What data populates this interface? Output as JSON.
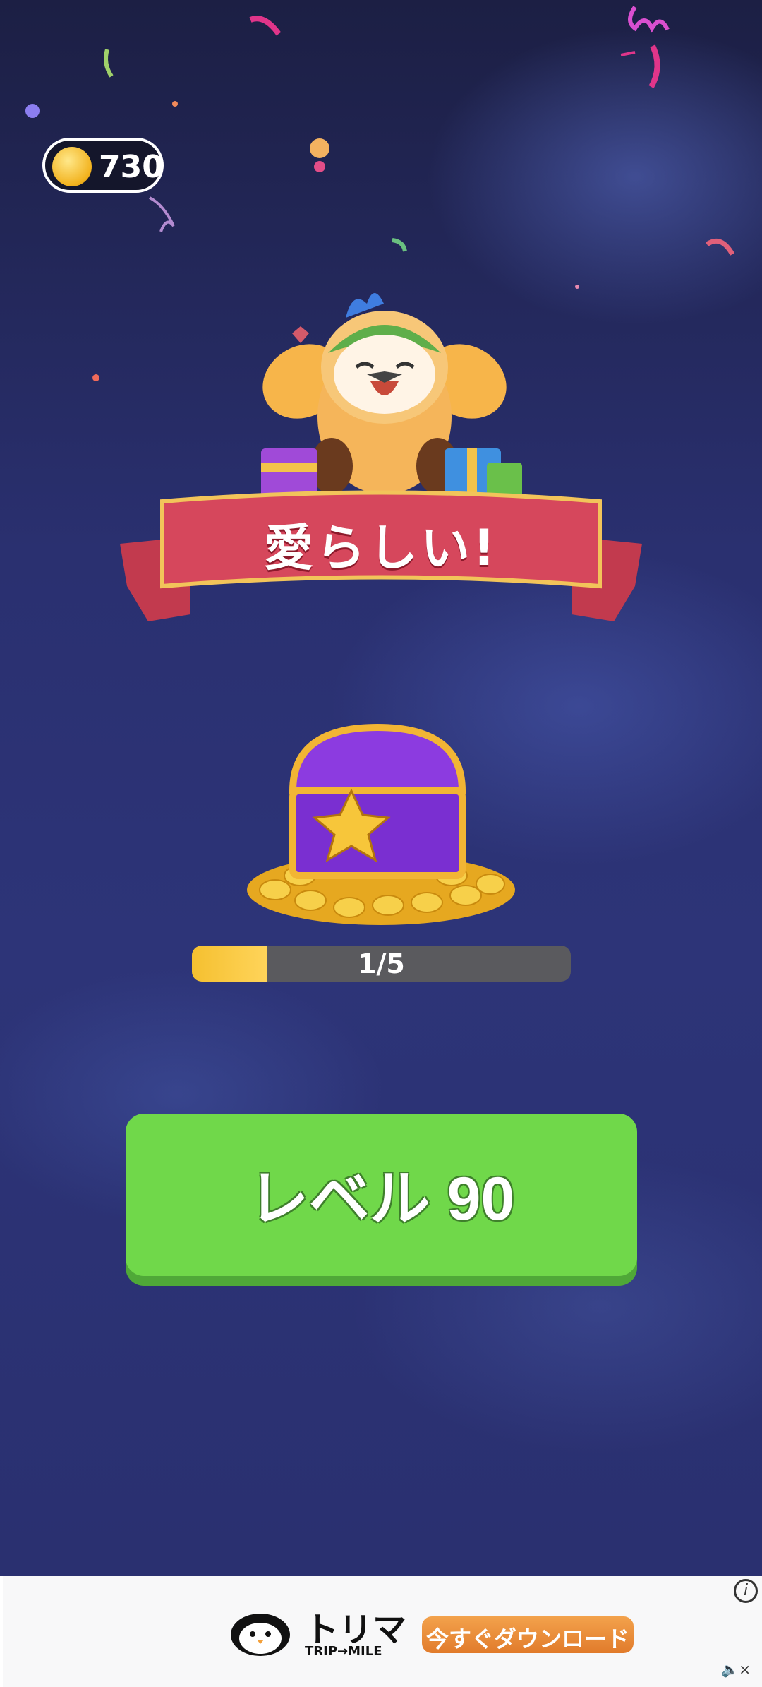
{
  "coins": {
    "count": "730"
  },
  "banner": {
    "text": "愛らしい!"
  },
  "progress": {
    "current": 1,
    "total": 5,
    "label": "1/5",
    "fraction": 0.2
  },
  "level_button": {
    "label": "レベル 90"
  },
  "ad": {
    "brand": "トリマ",
    "brand_sub": "TRIP→MILE",
    "cta": "今すぐダウンロード",
    "info_icon": "info-icon",
    "mute_icon": "mute-icon"
  },
  "colors": {
    "accent_green": "#70d84a",
    "banner_red": "#d6475c",
    "progress_yellow": "#f5c030",
    "chest_purple": "#7a2fd1"
  }
}
